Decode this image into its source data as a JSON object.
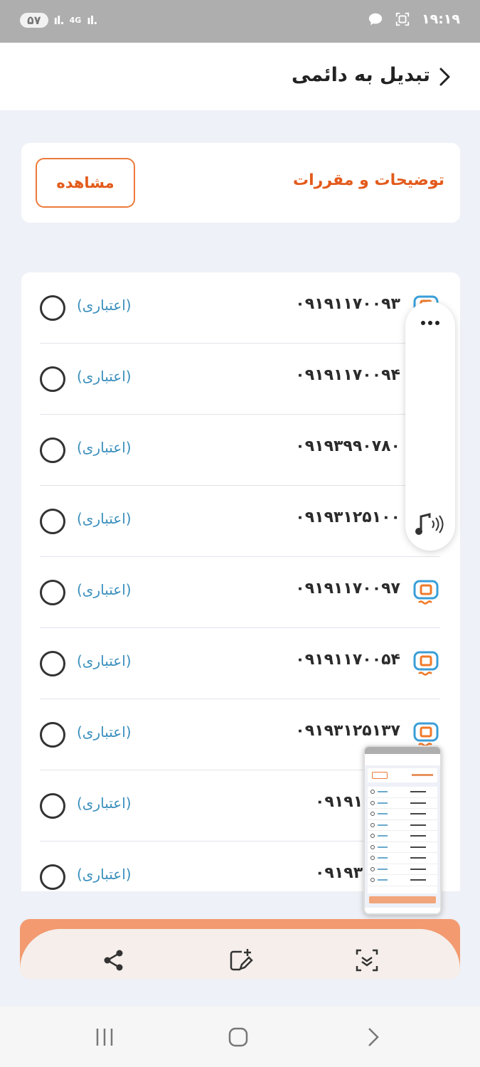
{
  "status_bar": {
    "battery": "۵۷",
    "network": "4G",
    "time": "۱۹:۱۹"
  },
  "header": {
    "title": "تبدیل به دائمی"
  },
  "rules_card": {
    "title": "توضیحات و مقررات",
    "view_label": "مشاهده"
  },
  "lines": [
    {
      "number": "۰۹۱۹۱۱۷۰۰۹۳",
      "type": "(اعتباری)"
    },
    {
      "number": "۰۹۱۹۱۱۷۰۰۹۴",
      "type": "(اعتباری)"
    },
    {
      "number": "۰۹۱۹۳۹۹۰۷۸۰",
      "type": "(اعتباری)"
    },
    {
      "number": "۰۹۱۹۳۱۲۵۱۰۰",
      "type": "(اعتباری)"
    },
    {
      "number": "۰۹۱۹۱۱۷۰۰۹۷",
      "type": "(اعتباری)"
    },
    {
      "number": "۰۹۱۹۱۱۷۰۰۵۴",
      "type": "(اعتباری)"
    },
    {
      "number": "۰۹۱۹۳۱۲۵۱۳۷",
      "type": "(اعتباری)"
    },
    {
      "number": "۰۹۱۹۱۱۷",
      "type": "(اعتباری)"
    },
    {
      "number": "۰۹۱۹۳۱۲",
      "type": "(اعتباری)"
    }
  ],
  "icons": {
    "sim": "sim-card-icon",
    "more": "more-dots-icon",
    "sound": "sound-icon",
    "share": "share-icon",
    "edit": "edit-screenshot-icon",
    "scroll_capture": "scroll-capture-icon"
  },
  "colors": {
    "accent": "#e35b1c",
    "tag": "#3a8fbd",
    "button": "#f39a70",
    "background": "#eef1f7"
  }
}
